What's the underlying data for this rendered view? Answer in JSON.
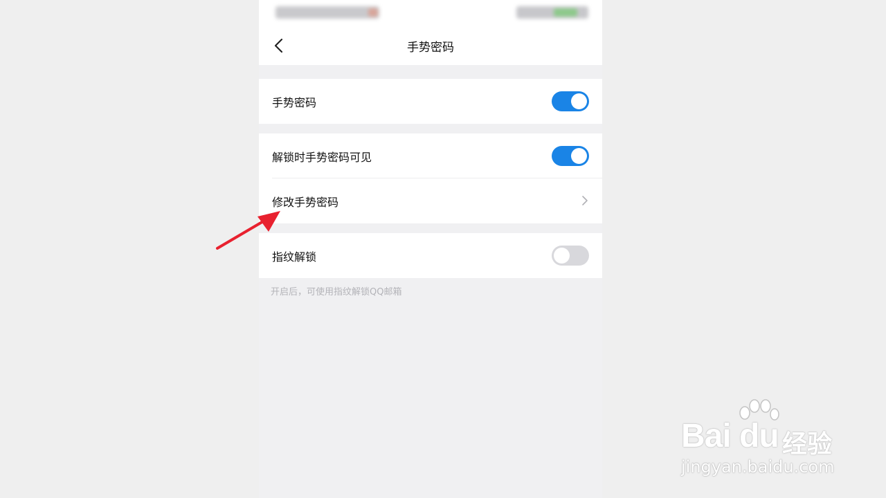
{
  "nav": {
    "title": "手势密码",
    "back_icon": "chevron-left-icon"
  },
  "settings": {
    "gesture_password": {
      "label": "手势密码",
      "enabled": true
    },
    "visible_when_unlocking": {
      "label": "解锁时手势密码可见",
      "enabled": true
    },
    "change_gesture_password": {
      "label": "修改手势密码",
      "icon": "chevron-right-icon"
    },
    "fingerprint_unlock": {
      "label": "指纹解锁",
      "enabled": false
    },
    "fingerprint_hint": "开启后，可使用指纹解锁QQ邮箱"
  },
  "colors": {
    "toggle_on": "#1a84e6",
    "toggle_off": "#d8d8dc",
    "annotation_arrow": "#e8212f"
  },
  "watermark": {
    "logo_text": "Bai du",
    "suffix": "经验",
    "url": "jingyan.baidu.com"
  }
}
